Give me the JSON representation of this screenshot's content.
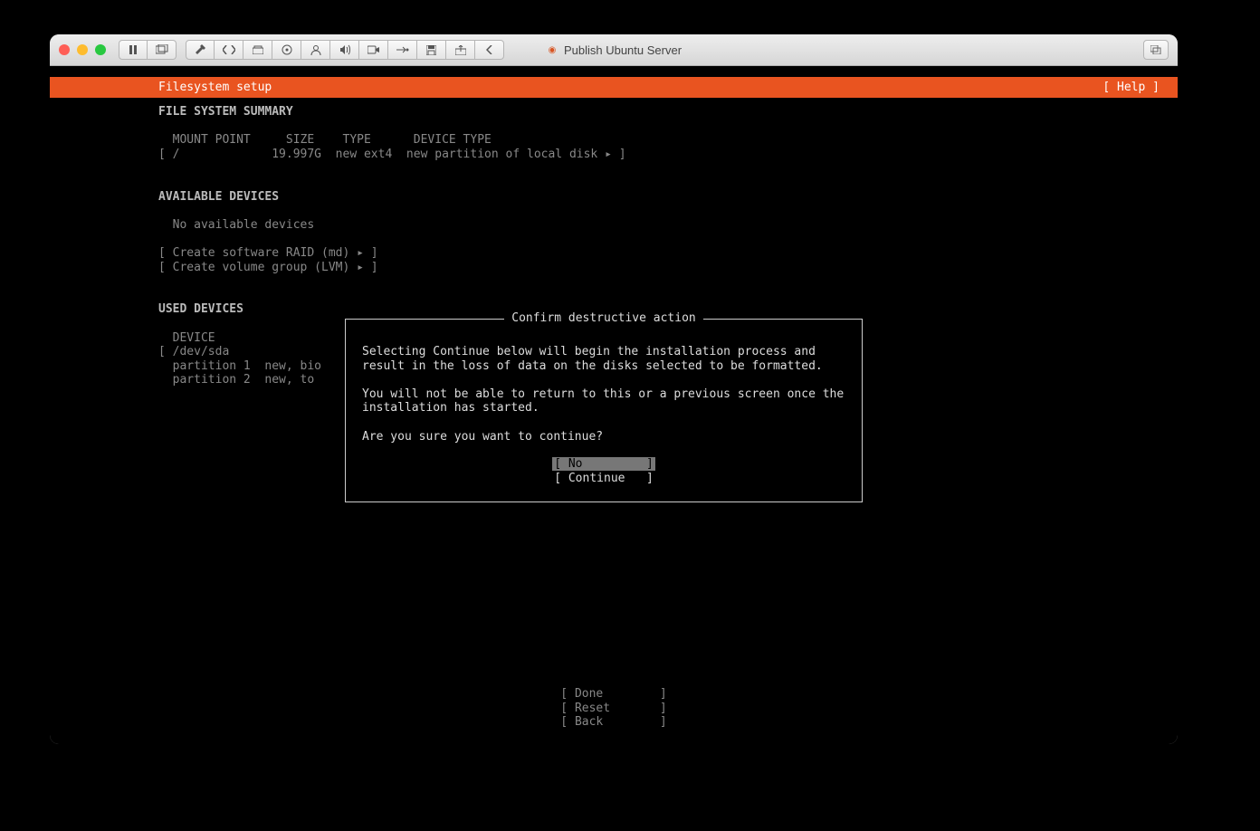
{
  "window": {
    "title": "Publish Ubuntu Server"
  },
  "header": {
    "title": "Filesystem setup",
    "help": "[ Help ]"
  },
  "summary": {
    "heading": "FILE SYSTEM SUMMARY",
    "cols": "  MOUNT POINT     SIZE    TYPE      DEVICE TYPE",
    "row": "[ /             19.997G  new ext4  new partition of local disk ▸ ]"
  },
  "available": {
    "heading": "AVAILABLE DEVICES",
    "none": "  No available devices",
    "raid": "[ Create software RAID (md) ▸ ]",
    "lvm": "[ Create volume group (LVM) ▸ ]"
  },
  "used": {
    "heading": "USED DEVICES",
    "device_col": "  DEVICE",
    "sda": "[ /dev/sda",
    "p1": "  partition 1  new, bio",
    "p2": "  partition 2  new, to"
  },
  "footer": {
    "done": "[ Done        ]",
    "reset": "[ Reset       ]",
    "back": "[ Back        ]"
  },
  "dialog": {
    "title": "Confirm destructive action",
    "p1": "Selecting Continue below will begin the installation process and result in the loss of data on the disks selected to be formatted.",
    "p2": "You will not be able to return to this or a previous screen once the installation has started.",
    "p3": "Are you sure you want to continue?",
    "no": "[ No         ]",
    "continue": "[ Continue   ]"
  }
}
